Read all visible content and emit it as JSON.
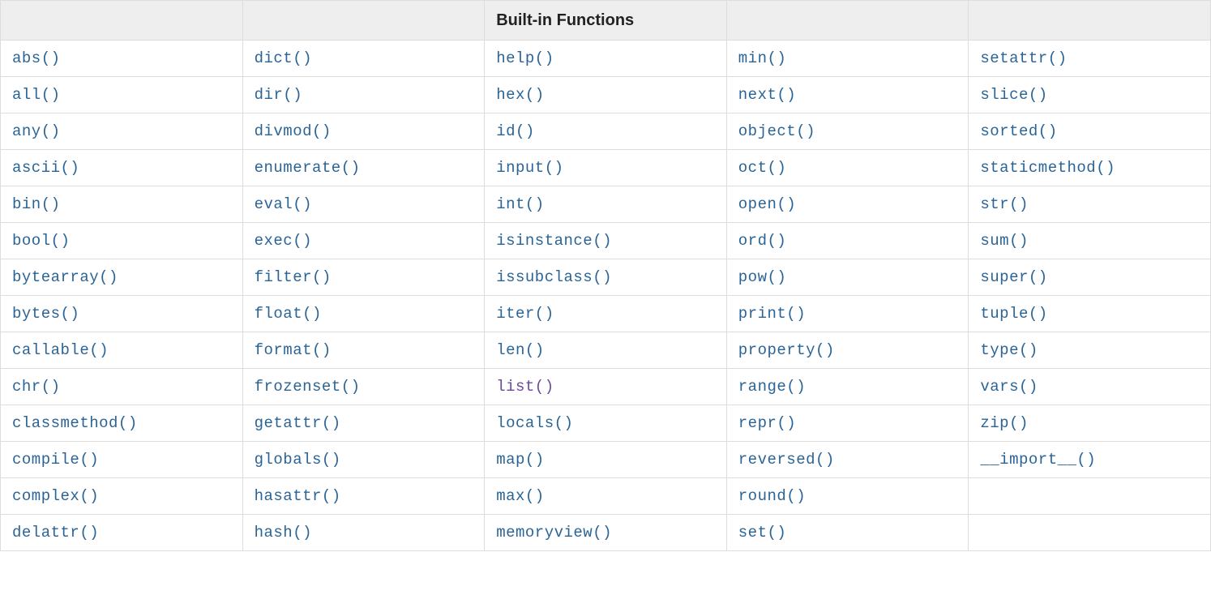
{
  "header": {
    "col1": "",
    "col2": "",
    "col3": "Built-in Functions",
    "col4": "",
    "col5": ""
  },
  "columns": [
    [
      "abs()",
      "all()",
      "any()",
      "ascii()",
      "bin()",
      "bool()",
      "bytearray()",
      "bytes()",
      "callable()",
      "chr()",
      "classmethod()",
      "compile()",
      "complex()",
      "delattr()"
    ],
    [
      "dict()",
      "dir()",
      "divmod()",
      "enumerate()",
      "eval()",
      "exec()",
      "filter()",
      "float()",
      "format()",
      "frozenset()",
      "getattr()",
      "globals()",
      "hasattr()",
      "hash()"
    ],
    [
      "help()",
      "hex()",
      "id()",
      "input()",
      "int()",
      "isinstance()",
      "issubclass()",
      "iter()",
      "len()",
      "list()",
      "locals()",
      "map()",
      "max()",
      "memoryview()"
    ],
    [
      "min()",
      "next()",
      "object()",
      "oct()",
      "open()",
      "ord()",
      "pow()",
      "print()",
      "property()",
      "range()",
      "repr()",
      "reversed()",
      "round()",
      "set()"
    ],
    [
      "setattr()",
      "slice()",
      "sorted()",
      "staticmethod()",
      "str()",
      "sum()",
      "super()",
      "tuple()",
      "type()",
      "vars()",
      "zip()",
      "__import__()",
      "",
      ""
    ]
  ],
  "visited": [
    "list()"
  ]
}
